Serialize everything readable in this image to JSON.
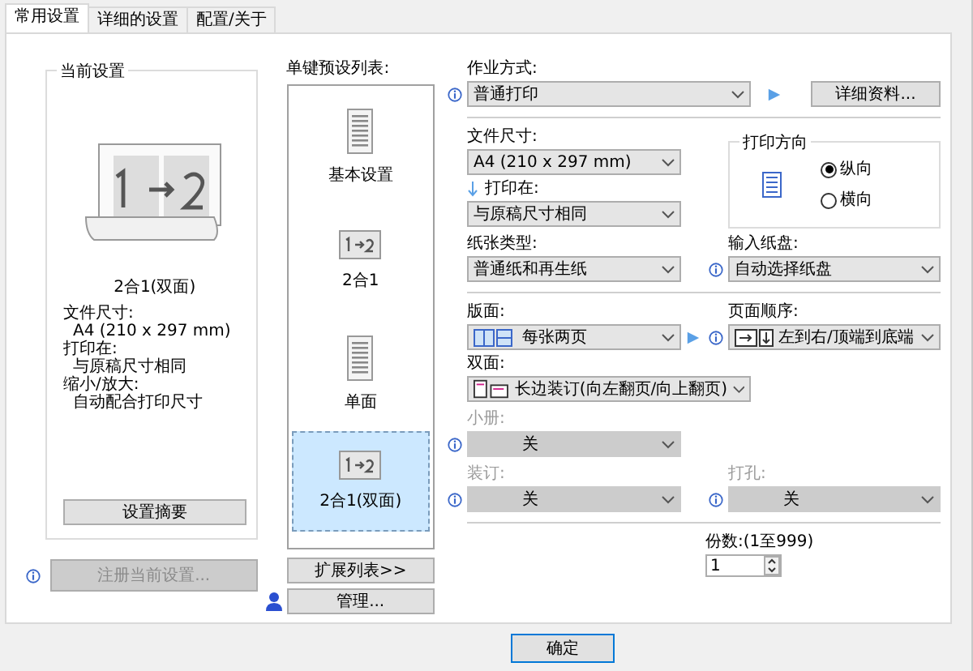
{
  "tabs": [
    {
      "label": "常用设置",
      "selected": true
    },
    {
      "label": "详细的设置",
      "selected": false
    },
    {
      "label": "配置/关于",
      "selected": false
    }
  ],
  "current_settings": {
    "title": "当前设置",
    "caption": "2合1(双面)",
    "details": [
      {
        "label": "文件尺寸:",
        "value": "A4 (210 x 297 mm)"
      },
      {
        "label": "打印在:",
        "value": "与原稿尺寸相同"
      },
      {
        "label": "缩小/放大:",
        "value": "自动配合打印尺寸"
      }
    ],
    "summary_button": "设置摘要",
    "register_button": {
      "label": "注册当前设置...",
      "disabled": true
    }
  },
  "presets": {
    "title": "单键预设列表:",
    "items": [
      {
        "label": "基本设置",
        "kind": "document",
        "selected": false
      },
      {
        "label": "2合1",
        "kind": "combine",
        "selected": false
      },
      {
        "label": "单面",
        "kind": "document",
        "selected": false
      },
      {
        "label": "2合1(双面)",
        "kind": "combine",
        "selected": true
      }
    ],
    "expand_button": "扩展列表>>",
    "manage_button": "管理..."
  },
  "job": {
    "label": "作业方式:",
    "value": "普通打印",
    "details_button": "详细资料..."
  },
  "document_size": {
    "label": "文件尺寸:",
    "value": "A4 (210 x 297 mm)"
  },
  "print_on": {
    "label": "打印在:",
    "value": "与原稿尺寸相同"
  },
  "orientation": {
    "title": "打印方向",
    "options": [
      {
        "label": "纵向",
        "selected": true
      },
      {
        "label": "横向",
        "selected": false
      }
    ]
  },
  "paper_type": {
    "label": "纸张类型:",
    "value": "普通纸和再生纸"
  },
  "input_tray": {
    "label": "输入纸盘:",
    "value": "自动选择纸盘"
  },
  "layout": {
    "label": "版面:",
    "value": "每张两页"
  },
  "page_order": {
    "label": "页面顺序:",
    "value": "左到右/顶端到底端"
  },
  "duplex": {
    "label": "双面:",
    "value": "长边装订(向左翻页/向上翻页)"
  },
  "booklet": {
    "label": "小册:",
    "value": "关",
    "disabled": true
  },
  "binding": {
    "label": "装订:",
    "value": "关",
    "disabled": true
  },
  "punch": {
    "label": "打孔:",
    "value": "关",
    "disabled": true
  },
  "copies": {
    "label": "份数:(1至999)",
    "value": "1"
  },
  "footer": {
    "ok_button": "确定"
  }
}
